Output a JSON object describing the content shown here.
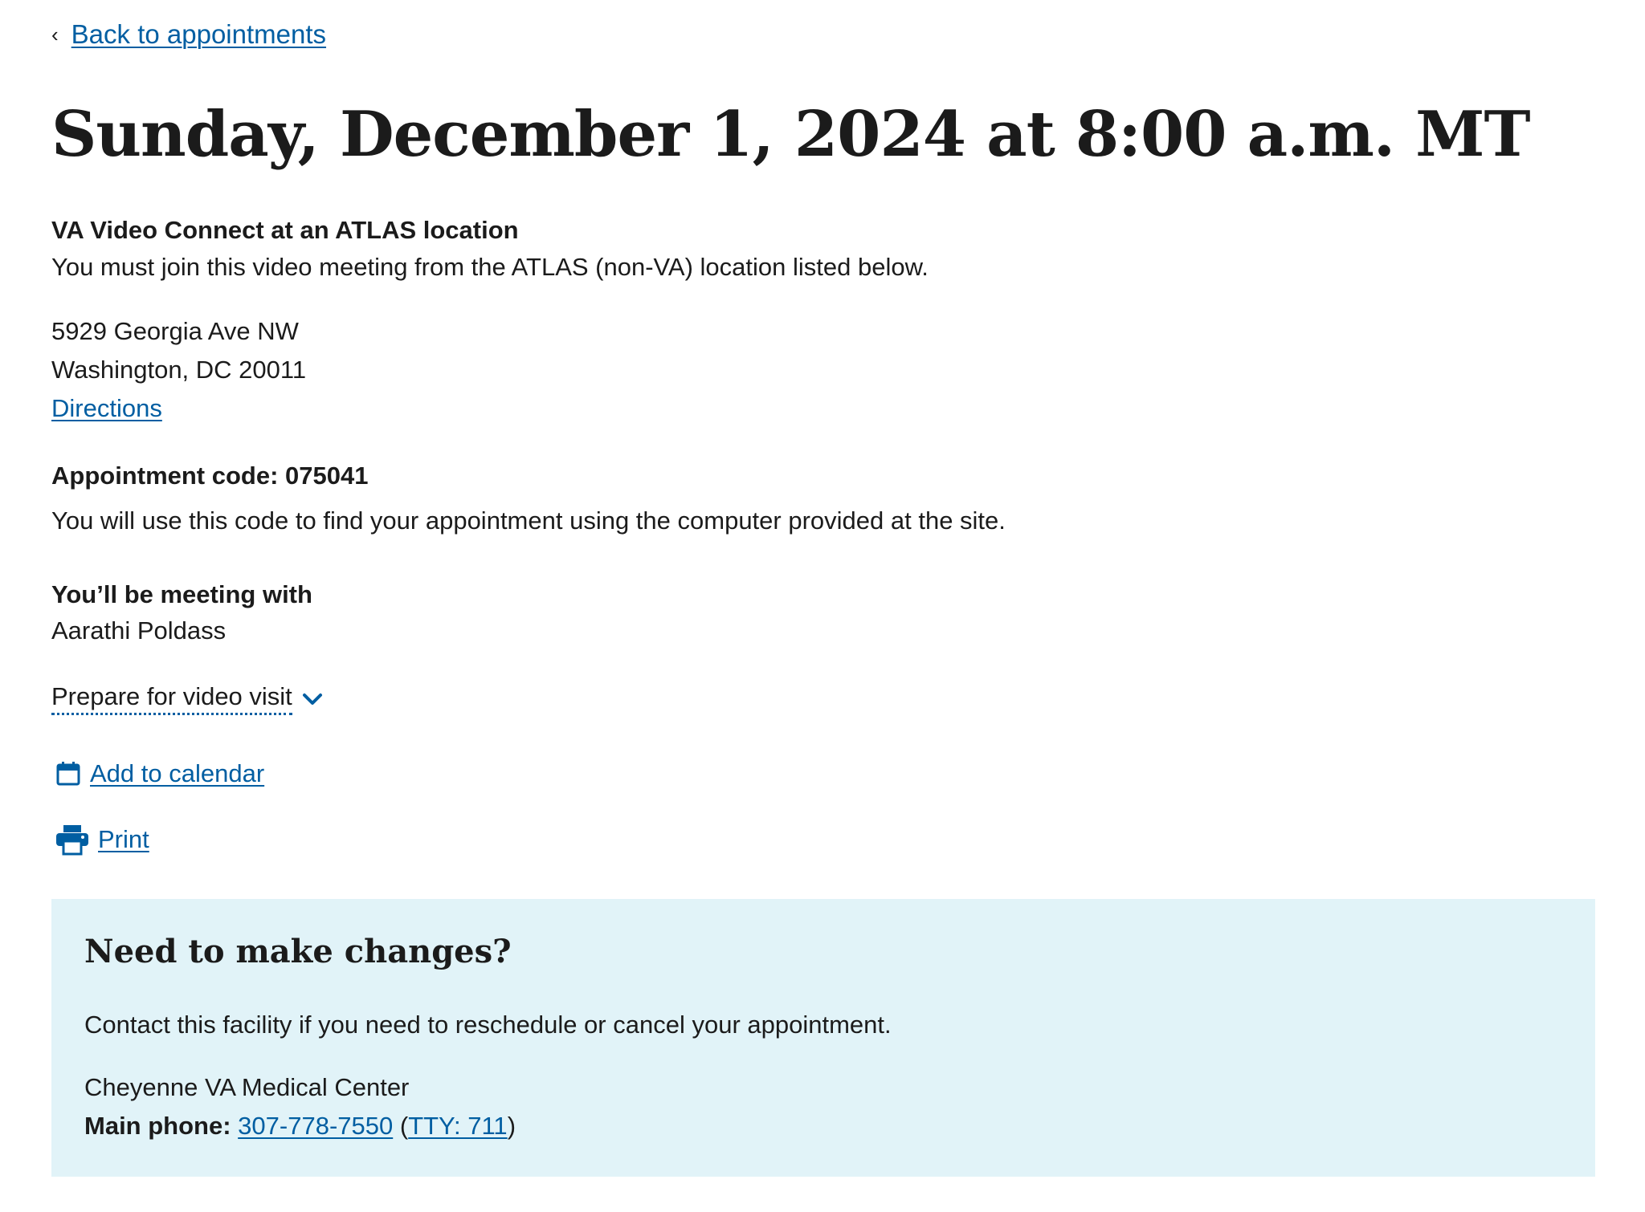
{
  "nav": {
    "back_chevron": "‹",
    "back_label": "Back to appointments"
  },
  "title": "Sunday, December 1, 2024 at 8:00 a.m. MT",
  "appointment": {
    "type_title": "VA Video Connect at an ATLAS location",
    "type_desc": "You must join this video meeting from the ATLAS (non-VA) location listed below.",
    "address_line1": "5929 Georgia Ave NW",
    "address_line2": "Washington, DC 20011",
    "directions_label": "Directions",
    "code_label": "Appointment code: 075041",
    "code_desc": "You will use this code to find your appointment using the computer provided at the site.",
    "meeting_title": "You’ll be meeting with",
    "provider_name": "Aarathi Poldass",
    "prepare_label": "Prepare for video visit"
  },
  "actions": {
    "calendar_label": "Add to calendar",
    "calendar_icon": "calendar-icon",
    "print_label": "Print",
    "print_icon": "printer-icon"
  },
  "changes": {
    "heading": "Need to make changes?",
    "description": "Contact this facility if you need to reschedule or cancel your appointment.",
    "facility_name": "Cheyenne VA Medical Center",
    "phone_label": "Main phone:",
    "phone_number": "307-778-7550",
    "tty_open": "(",
    "tty_label": "TTY: 711",
    "tty_close": ")"
  },
  "colors": {
    "link": "#005ea2",
    "text": "#1b1b1b",
    "panel_bg": "#e1f3f8"
  }
}
